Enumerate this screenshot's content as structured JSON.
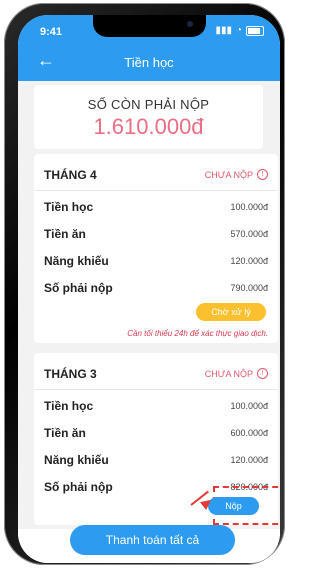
{
  "status_bar": {
    "time": "9:41"
  },
  "header": {
    "back_icon": "arrow-left-icon",
    "title": "Tiền học"
  },
  "summary": {
    "label": "SỐ CÒN PHẢI NỘP",
    "amount": "1.610.000đ"
  },
  "cards": [
    {
      "month": "THÁNG 4",
      "status": "CHƯA NỘP",
      "rows": [
        {
          "label": "Tiền học",
          "value": "100.000đ"
        },
        {
          "label": "Tiền ăn",
          "value": "570.000đ"
        },
        {
          "label": "Năng khiếu",
          "value": "120.000đ"
        },
        {
          "label": "Số  phải nộp",
          "value": "790.000đ"
        }
      ],
      "action": "Chờ xử lý",
      "note": "Cần tối thiểu 24h để xác thực giao dịch."
    },
    {
      "month": "THÁNG 3",
      "status": "CHƯA NỘP",
      "rows": [
        {
          "label": "Tiền học",
          "value": "100.000đ"
        },
        {
          "label": "Tiền ăn",
          "value": "600.000đ"
        },
        {
          "label": "Năng khiếu",
          "value": "120.000đ"
        },
        {
          "label": "Số  phải nộp",
          "value": "820.000đ"
        }
      ],
      "action": "Nộp"
    }
  ],
  "footer": {
    "pay_all": "Thanh toán tất cả"
  },
  "colors": {
    "primary": "#2d9bf0",
    "pending": "#fbc02d",
    "alert": "#e05a6c",
    "amount": "#ec6e84"
  }
}
